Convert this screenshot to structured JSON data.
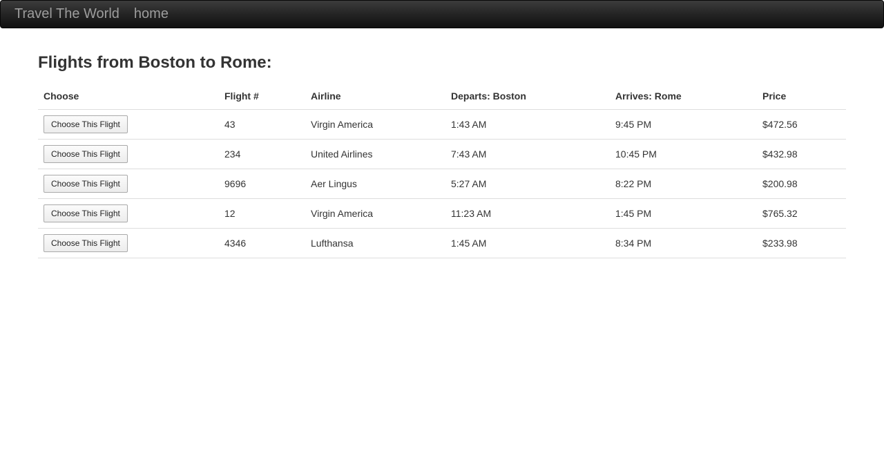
{
  "navbar": {
    "brand": "Travel The World",
    "links": [
      "home"
    ]
  },
  "page": {
    "title": "Flights from Boston to Rome:"
  },
  "table": {
    "headers": [
      "Choose",
      "Flight #",
      "Airline",
      "Departs: Boston",
      "Arrives: Rome",
      "Price"
    ],
    "button_label": "Choose This Flight",
    "rows": [
      {
        "flight": "43",
        "airline": "Virgin America",
        "departs": "1:43 AM",
        "arrives": "9:45 PM",
        "price": "$472.56"
      },
      {
        "flight": "234",
        "airline": "United Airlines",
        "departs": "7:43 AM",
        "arrives": "10:45 PM",
        "price": "$432.98"
      },
      {
        "flight": "9696",
        "airline": "Aer Lingus",
        "departs": "5:27 AM",
        "arrives": "8:22 PM",
        "price": "$200.98"
      },
      {
        "flight": "12",
        "airline": "Virgin America",
        "departs": "11:23 AM",
        "arrives": "1:45 PM",
        "price": "$765.32"
      },
      {
        "flight": "4346",
        "airline": "Lufthansa",
        "departs": "1:45 AM",
        "arrives": "8:34 PM",
        "price": "$233.98"
      }
    ]
  },
  "colors": {
    "navbar_bg": "#222222",
    "navbar_text": "#9d9d9d",
    "text": "#333333",
    "row_border": "#dddddd"
  }
}
